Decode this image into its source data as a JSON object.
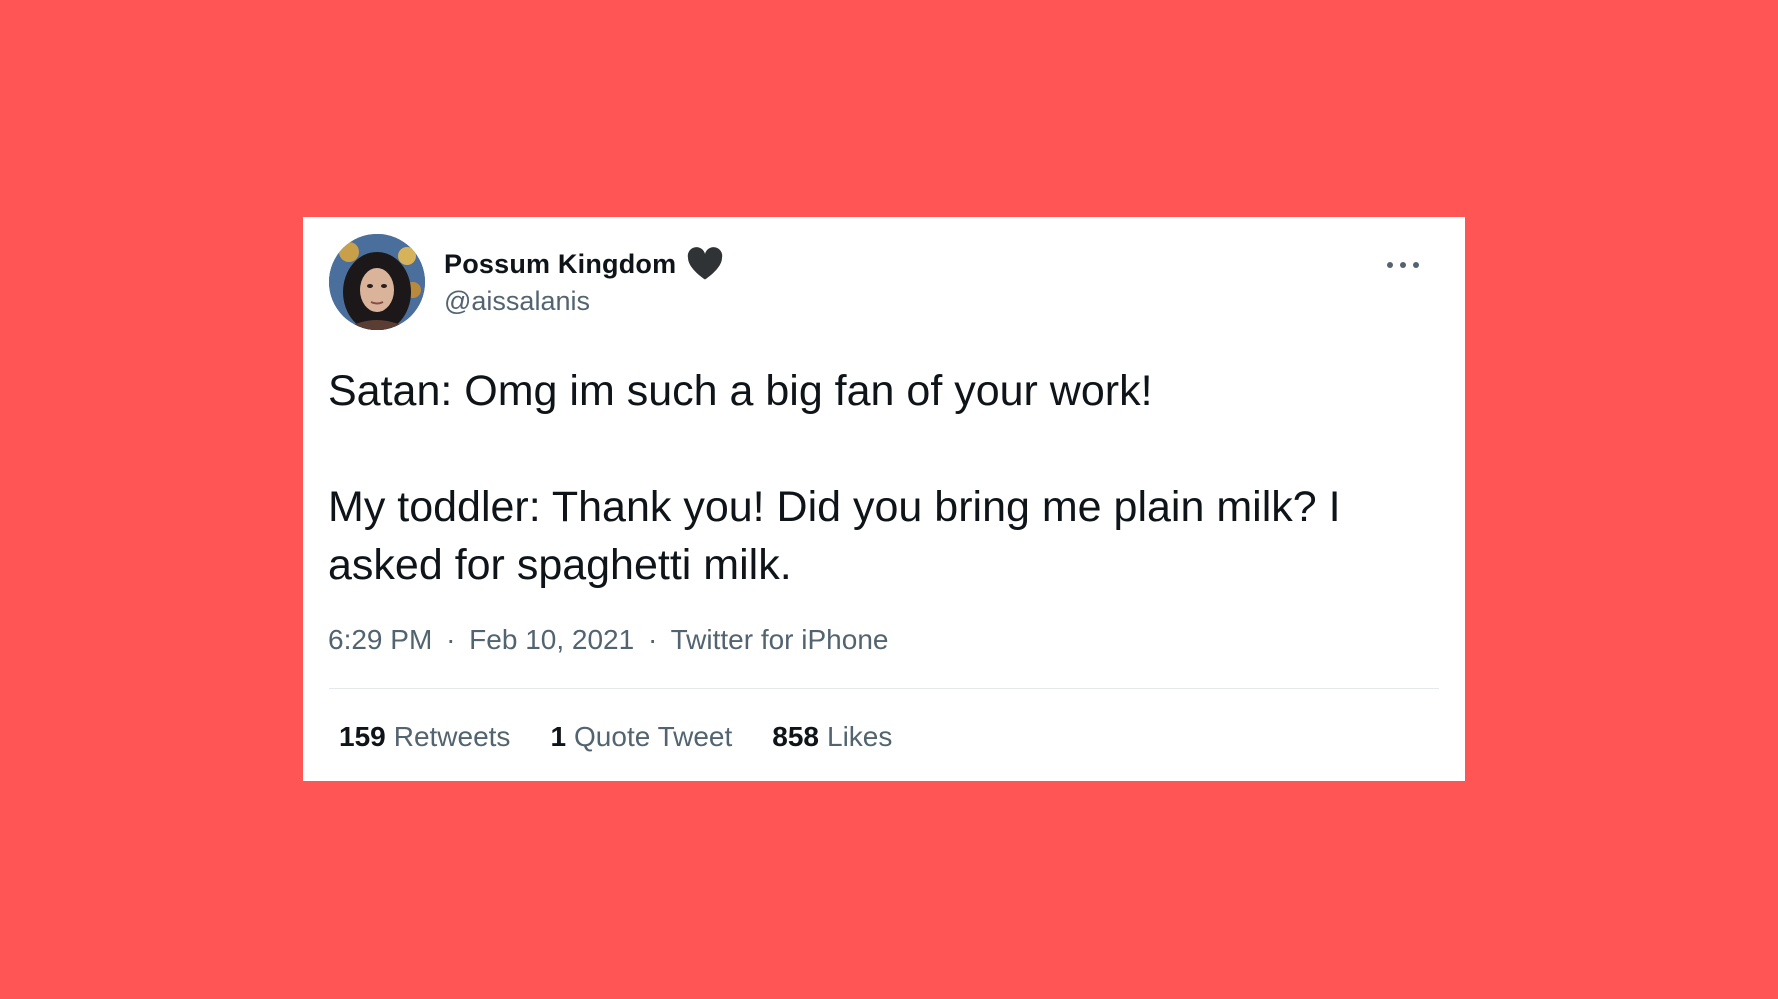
{
  "colors": {
    "background": "#FF5555",
    "card": "#FFFFFF",
    "primary_text": "#0F1419",
    "secondary_text": "#536471"
  },
  "user": {
    "display_name": "Possum Kingdom",
    "handle": "@aissalanis",
    "badge_icon": "black-heart-icon",
    "avatar_icon": "avatar"
  },
  "more_icon": "more-options-icon",
  "tweet": {
    "line1": "Satan: Omg im such a big fan of your work!",
    "line2": "My toddler: Thank you! Did you bring me plain milk? I asked for spaghetti milk."
  },
  "meta": {
    "time": "6:29 PM",
    "date": "Feb 10, 2021",
    "source": "Twitter for iPhone",
    "separator": "·"
  },
  "stats": {
    "retweets_count": "159",
    "retweets_label": "Retweets",
    "quotes_count": "1",
    "quotes_label": "Quote Tweet",
    "likes_count": "858",
    "likes_label": "Likes"
  }
}
